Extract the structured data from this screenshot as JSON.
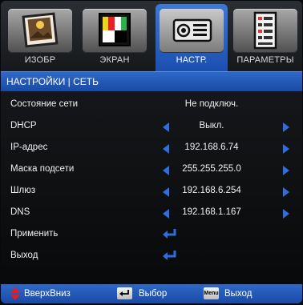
{
  "tabs": [
    {
      "label": "ИЗОБР",
      "icon": "picture-icon",
      "active": false
    },
    {
      "label": "ЭКРАН",
      "icon": "display-icon",
      "active": false
    },
    {
      "label": "НАСТР.",
      "icon": "projector-icon",
      "active": true
    },
    {
      "label": "ПАРАМЕТРЫ",
      "icon": "options-icon",
      "active": false
    }
  ],
  "header": {
    "title": "НАСТРОЙКИ | СЕТЬ"
  },
  "rows": [
    {
      "label": "Состояние сети",
      "value": "Не подключ."
    },
    {
      "label": "DHCP",
      "value": "Выкл."
    },
    {
      "label": "IP-адрес",
      "value": "192.168.6.74"
    },
    {
      "label": "Маска подсети",
      "value": "255.255.255.0"
    },
    {
      "label": "Шлюз",
      "value": "192.168.6.254"
    },
    {
      "label": "DNS",
      "value": "192.168.1.167"
    },
    {
      "label": "Применить"
    },
    {
      "label": "Выход"
    }
  ],
  "footer": {
    "updown_label": "ВверхВниз",
    "select_label": "Выбор",
    "menu_key": "Menu",
    "exit_label": "Выход"
  },
  "colors": {
    "accent": "#1f56b8",
    "arrow": "#2d6fe0",
    "background": "#0b0c0e"
  }
}
